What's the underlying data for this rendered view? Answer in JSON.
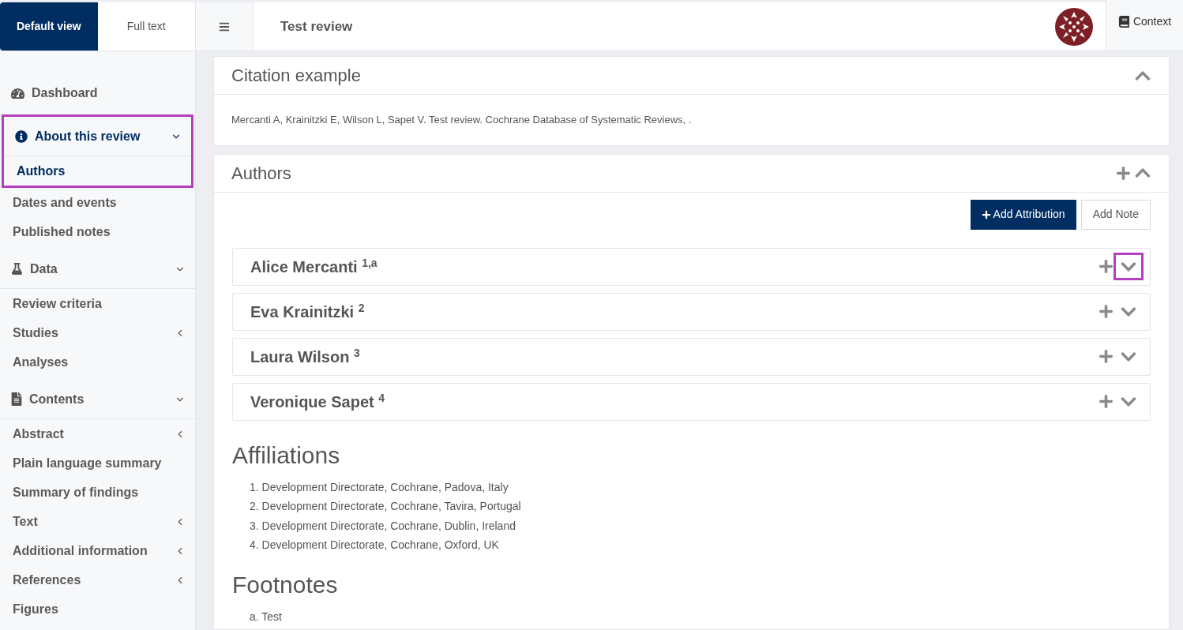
{
  "view_tabs": [
    {
      "label": "Default view",
      "selected": true
    },
    {
      "label": "Full text",
      "selected": false
    }
  ],
  "header": {
    "title": "Test review",
    "context_button": "Context"
  },
  "sidebar": {
    "sections": [
      {
        "kind": "dashboard",
        "label": "Dashboard"
      },
      {
        "kind": "info",
        "label": "About this review",
        "expanded": true,
        "highlighted": true,
        "children": [
          {
            "label": "Authors",
            "selected": true
          },
          {
            "label": "Dates and events",
            "selected": false
          },
          {
            "label": "Published notes",
            "selected": false
          }
        ]
      },
      {
        "kind": "flask",
        "label": "Data",
        "expanded": true,
        "highlighted": false,
        "children": [
          {
            "label": "Review criteria",
            "selected": false
          },
          {
            "label": "Studies",
            "selected": false,
            "expanded": false
          },
          {
            "label": "Analyses",
            "selected": false
          }
        ]
      },
      {
        "kind": "file",
        "label": "Contents",
        "expanded": true,
        "highlighted": false,
        "children": [
          {
            "label": "Abstract",
            "selected": false,
            "expanded": false
          },
          {
            "label": "Plain language summary",
            "selected": false
          },
          {
            "label": "Summary of findings",
            "selected": false
          },
          {
            "label": "Text",
            "selected": false,
            "expanded": false
          },
          {
            "label": "Additional information",
            "selected": false,
            "expanded": false
          },
          {
            "label": "References",
            "selected": false,
            "expanded": false
          },
          {
            "label": "Figures",
            "selected": false
          }
        ]
      }
    ]
  },
  "citation_panel": {
    "title": "Citation example",
    "expanded": true,
    "text": "Mercanti A, Krainitzki E, Wilson L, Sapet V. Test review. Cochrane Database of Systematic Reviews, ."
  },
  "authors_panel": {
    "title": "Authors",
    "expanded": true,
    "buttons": [
      {
        "label": "Add Attribution",
        "kind": "primary"
      },
      {
        "label": "Add Note",
        "kind": "secondary"
      }
    ],
    "authors": [
      {
        "name": "Alice Mercanti $^{1,a}$",
        "expanded": false,
        "highlighted": true
      },
      {
        "name": "Eva Krainitzki $^{2}$",
        "expanded": false,
        "highlighted": false
      },
      {
        "name": "Laura Wilson $^{3}$",
        "expanded": false,
        "highlighted": false
      },
      {
        "name": "Veronique Sapet $^{4}$",
        "expanded": false,
        "highlighted": false
      }
    ],
    "affiliations": {
      "heading": "Affiliations",
      "items": [
        {
          "number": "1.",
          "text": "Development Directorate, Cochrane, Padova, Italy"
        },
        {
          "number": "2.",
          "text": "Development Directorate, Cochrane, Tavira, Portugal"
        },
        {
          "number": "3.",
          "text": "Development Directorate, Cochrane, Dublin, Ireland"
        },
        {
          "number": "4.",
          "text": "Development Directorate, Cochrane, Oxford, UK"
        }
      ]
    },
    "footnotes": {
      "heading": "Footnotes",
      "items": [
        {
          "number": "a.",
          "text": "Test"
        }
      ]
    }
  }
}
